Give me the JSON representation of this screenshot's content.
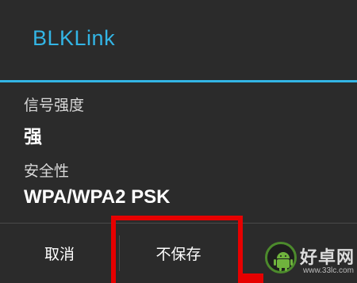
{
  "dialog": {
    "title": "BLKLink",
    "signal_strength_label": "信号强度",
    "signal_strength_value": "强",
    "security_label": "安全性",
    "security_value": "WPA/WPA2 PSK"
  },
  "buttons": {
    "cancel_label": "取消",
    "no_save_label": "不保存"
  },
  "watermark": {
    "brand_text": "好卓网",
    "url_text": "www.33lc.com"
  },
  "colors": {
    "accent": "#33b5e5",
    "dialog_background": "#2b2b2b",
    "highlight": "#e60000"
  },
  "icons": {
    "watermark_logo": "android-robot-icon"
  }
}
